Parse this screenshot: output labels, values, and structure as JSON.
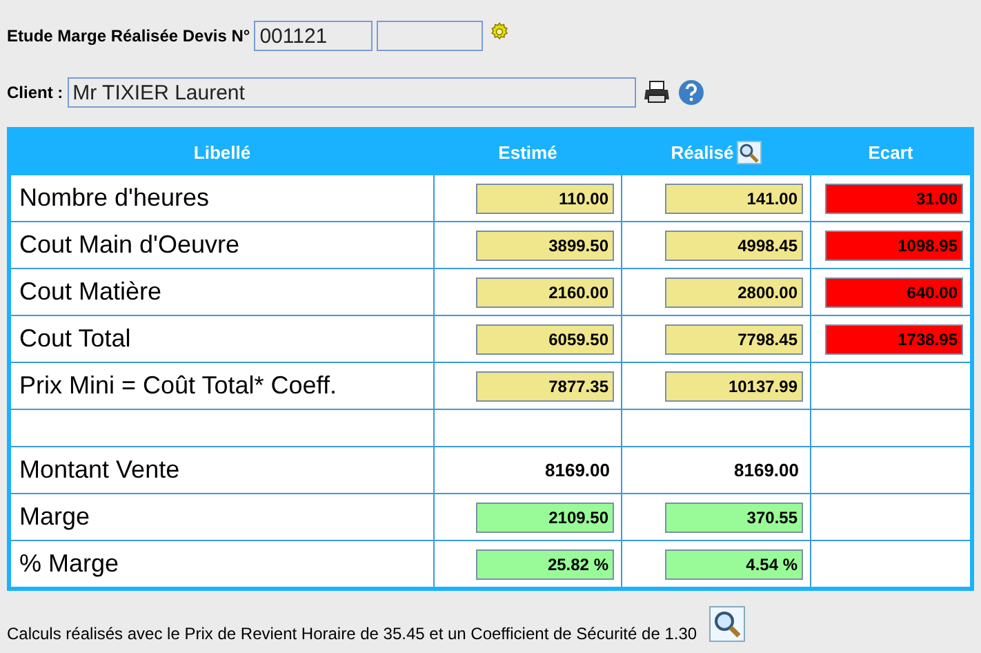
{
  "header": {
    "title": "Etude Marge Réalisée Devis N°",
    "devis_number": "001121",
    "client_label": "Client :",
    "client": "Mr TIXIER Laurent"
  },
  "table": {
    "columns": [
      {
        "label": "Libellé",
        "icon": false
      },
      {
        "label": "Estimé",
        "icon": false
      },
      {
        "label": "Réalisé",
        "icon": true
      },
      {
        "label": "Ecart",
        "icon": false
      }
    ],
    "rows": [
      {
        "label": "Nombre d'heures",
        "cells": [
          {
            "kind": "field",
            "value": "110.00",
            "color": "#f0e68c"
          },
          {
            "kind": "field",
            "value": "141.00",
            "color": "#f0e68c"
          },
          {
            "kind": "field",
            "value": "31.00",
            "color": "#ff0000"
          }
        ]
      },
      {
        "label": "Cout Main d'Oeuvre",
        "cells": [
          {
            "kind": "field",
            "value": "3899.50",
            "color": "#f0e68c"
          },
          {
            "kind": "field",
            "value": "4998.45",
            "color": "#f0e68c"
          },
          {
            "kind": "field",
            "value": "1098.95",
            "color": "#ff0000"
          }
        ]
      },
      {
        "label": "Cout Matière",
        "cells": [
          {
            "kind": "field",
            "value": "2160.00",
            "color": "#f0e68c"
          },
          {
            "kind": "field",
            "value": "2800.00",
            "color": "#f0e68c"
          },
          {
            "kind": "field",
            "value": "640.00",
            "color": "#ff0000"
          }
        ]
      },
      {
        "label": "Cout Total",
        "cells": [
          {
            "kind": "field",
            "value": "6059.50",
            "color": "#f0e68c"
          },
          {
            "kind": "field",
            "value": "7798.45",
            "color": "#f0e68c"
          },
          {
            "kind": "field",
            "value": "1738.95",
            "color": "#ff0000"
          }
        ]
      },
      {
        "label": "Prix Mini = Coût Total* Coeff.",
        "cells": [
          {
            "kind": "field",
            "value": "7877.35",
            "color": "#f0e68c"
          },
          {
            "kind": "field",
            "value": "10137.99",
            "color": "#f0e68c"
          },
          {
            "kind": "empty"
          }
        ]
      },
      {
        "kind": "spacer"
      },
      {
        "label": "Montant Vente",
        "cells": [
          {
            "kind": "text",
            "value": "8169.00"
          },
          {
            "kind": "text",
            "value": "8169.00"
          },
          {
            "kind": "empty"
          }
        ]
      },
      {
        "label": "Marge",
        "cells": [
          {
            "kind": "field",
            "value": "2109.50",
            "color": "#98fb98"
          },
          {
            "kind": "field",
            "value": "370.55",
            "color": "#98fb98"
          },
          {
            "kind": "empty"
          }
        ]
      },
      {
        "label": "% Marge",
        "cells": [
          {
            "kind": "field",
            "value": "25.82 %",
            "color": "#98fb98"
          },
          {
            "kind": "field",
            "value": "4.54 %",
            "color": "#98fb98"
          },
          {
            "kind": "empty"
          }
        ]
      }
    ]
  },
  "footer": "Calculs réalisés avec le Prix de Revient Horaire de 35.45 et un Coefficient de Sécurité de 1.30"
}
